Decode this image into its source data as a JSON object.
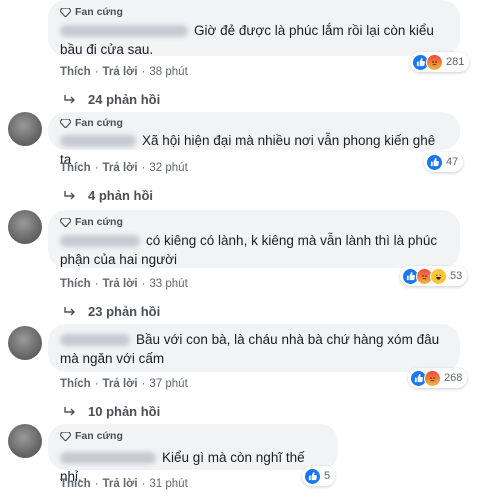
{
  "comments": [
    {
      "badge": "Fan cứng",
      "text": "Giờ đẻ được là phúc lắm rồi lại còn kiểu bầu đi cửa sau.",
      "actions": {
        "like": "Thích",
        "reply": "Trả lời",
        "time": "38 phút"
      },
      "reaction_count": "281",
      "reaction_types": [
        "like-icon",
        "angry-icon"
      ],
      "replies": "24 phản hồi"
    },
    {
      "badge": "Fan cứng",
      "text": "Xã hội hiện đại mà nhiều nơi vẫn phong kiến ghê ta",
      "actions": {
        "like": "Thích",
        "reply": "Trả lời",
        "time": "32 phút"
      },
      "reaction_count": "47",
      "reaction_types": [
        "like-icon"
      ],
      "replies": "4 phản hồi"
    },
    {
      "badge": "Fan cứng",
      "text": "có kiêng có lành, k kiêng mà vẫn lành thì là phúc phận của hai người",
      "actions": {
        "like": "Thích",
        "reply": "Trả lời",
        "time": "33 phút"
      },
      "reaction_count": "53",
      "reaction_types": [
        "like-icon",
        "angry-icon",
        "haha-icon"
      ],
      "replies": "23 phản hồi"
    },
    {
      "badge": "",
      "text": "Bầu với con bà, là cháu nhà bà chứ hàng xóm đâu mà ngăn với cấm",
      "actions": {
        "like": "Thích",
        "reply": "Trả lời",
        "time": "37 phút"
      },
      "reaction_count": "268",
      "reaction_types": [
        "like-icon",
        "angry-icon"
      ],
      "replies": "10 phản hồi"
    },
    {
      "badge": "Fan cứng",
      "text": "Kiểu gì mà còn nghĩ thế nhỉ.",
      "actions": {
        "like": "Thích",
        "reply": "Trả lời",
        "time": "31 phút"
      },
      "reaction_count": "5",
      "reaction_types": [
        "like-icon"
      ],
      "replies": ""
    }
  ],
  "colors": {
    "like": "#1877f2",
    "bubble": "#f2f3f5",
    "meta": "#606770"
  }
}
